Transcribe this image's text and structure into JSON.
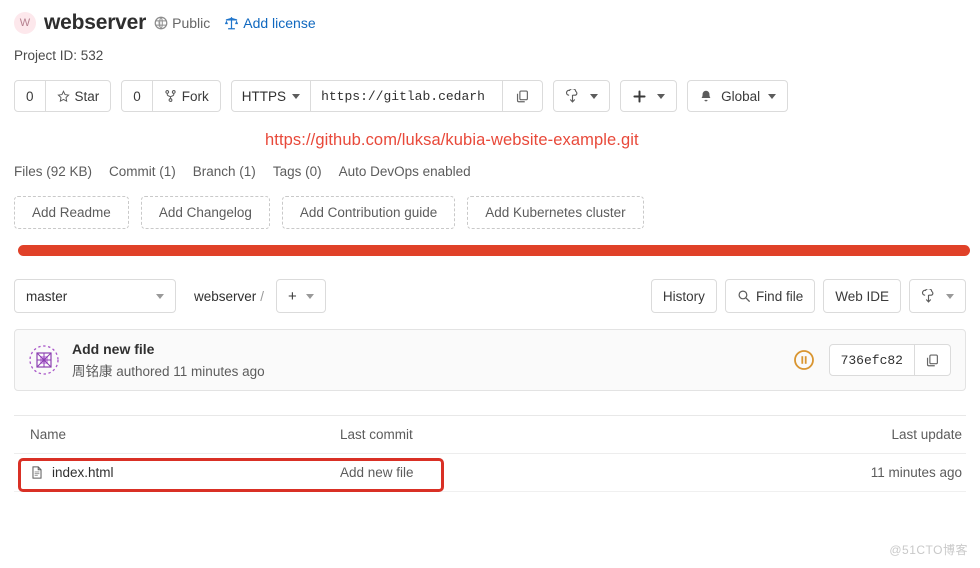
{
  "header": {
    "avatar_initial": "W",
    "project_name": "webserver",
    "visibility": "Public",
    "visibility_icon": "globe-icon",
    "license_label": "Add license",
    "license_icon": "scale-icon",
    "project_id": "Project ID: 532"
  },
  "toolbar": {
    "star_count": "0",
    "star_label": "Star",
    "star_icon": "star-icon",
    "fork_count": "0",
    "fork_label": "Fork",
    "fork_icon": "fork-icon",
    "clone_protocol": "HTTPS",
    "clone_url": "https://gitlab.cedarh",
    "copy_icon": "copy-icon",
    "download_icon": "download-icon",
    "plus_icon": "plus-icon",
    "notification_label": "Global",
    "notification_icon": "bell-icon"
  },
  "annotation": {
    "url_text": "https://github.com/luksa/kubia-website-example.git",
    "url_color": "#e8493a",
    "bar_color": "#e04128",
    "box_color": "#d93025"
  },
  "stats": [
    "Files (92 KB)",
    "Commit (1)",
    "Branch (1)",
    "Tags (0)",
    "Auto DevOps enabled"
  ],
  "quick_actions": [
    "Add Readme",
    "Add Changelog",
    "Add Contribution guide",
    "Add Kubernetes cluster"
  ],
  "branch_row": {
    "branch": "master",
    "breadcrumb_root": "webserver",
    "breadcrumb_sep": "/",
    "plus_label": "+",
    "history_label": "History",
    "find_file_label": "Find file",
    "find_file_icon": "search-icon",
    "web_ide_label": "Web IDE",
    "download_icon": "download-icon"
  },
  "commit": {
    "avatar_icon": "identicon-avatar",
    "title": "Add new file",
    "author": "周铭康",
    "meta": "周铭康 authored 11 minutes ago",
    "pipeline_status_icon": "pipeline-pending-icon",
    "pipeline_status_color": "#d99530",
    "sha": "736efc82",
    "copy_icon": "copy-icon"
  },
  "files": {
    "columns": [
      "Name",
      "Last commit",
      "Last update"
    ],
    "rows": [
      {
        "icon": "file-icon",
        "name": "index.html",
        "last_commit": "Add new file",
        "last_update": "11 minutes ago"
      }
    ]
  },
  "watermark": "@51CTO博客"
}
